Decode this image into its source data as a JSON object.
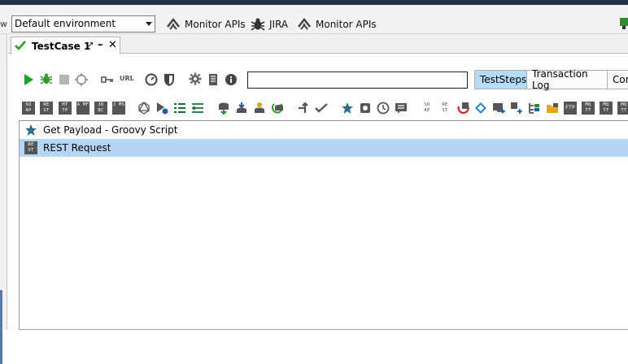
{
  "toolbar": {
    "left_edge_label": "w",
    "environment": {
      "selected": "Default environment"
    },
    "links": [
      {
        "label": "Monitor APIs",
        "icon": "monitor-api-icon"
      },
      {
        "label": "JIRA",
        "icon": "bug-icon"
      },
      {
        "label": "Monitor APIs",
        "icon": "monitor-api-icon"
      }
    ]
  },
  "tab": {
    "title": "TestCase 1",
    "check_color": "#2e9b2e"
  },
  "testcase_toolbar": {
    "icons": [
      "run-icon",
      "debug-icon",
      "stop-icon",
      "loop-icon",
      "key-icon",
      "url-icon",
      "gauge-icon",
      "shield-icon",
      "gear-icon",
      "document-icon",
      "info-icon"
    ],
    "url_label": "URL",
    "search_value": "",
    "view_tabs": [
      {
        "label": "TestSteps",
        "active": true
      },
      {
        "label": "Transaction Log",
        "active": false
      },
      {
        "label": "Cor",
        "active": false
      }
    ]
  },
  "step_icons": {
    "labels": [
      "SO AP",
      "RE ST",
      "HT TP",
      "A MF",
      "JD BC",
      "J MS"
    ],
    "right_labels": [
      "SO AP",
      "RE ST"
    ],
    "trailing_labels": [
      "FTP",
      "MQ TT",
      "MQ TT",
      "MQ TT"
    ]
  },
  "steps": [
    {
      "label": "Get Payload - Groovy Script",
      "icon": "star-icon",
      "selected": false
    },
    {
      "label": "REST Request",
      "icon": "rest-icon",
      "icon_text": "RE ST",
      "selected": true
    }
  ],
  "colors": {
    "accent_tab": "#b5dcf6",
    "selected_row": "#b5d5f5",
    "star": "#2f6c8e"
  }
}
